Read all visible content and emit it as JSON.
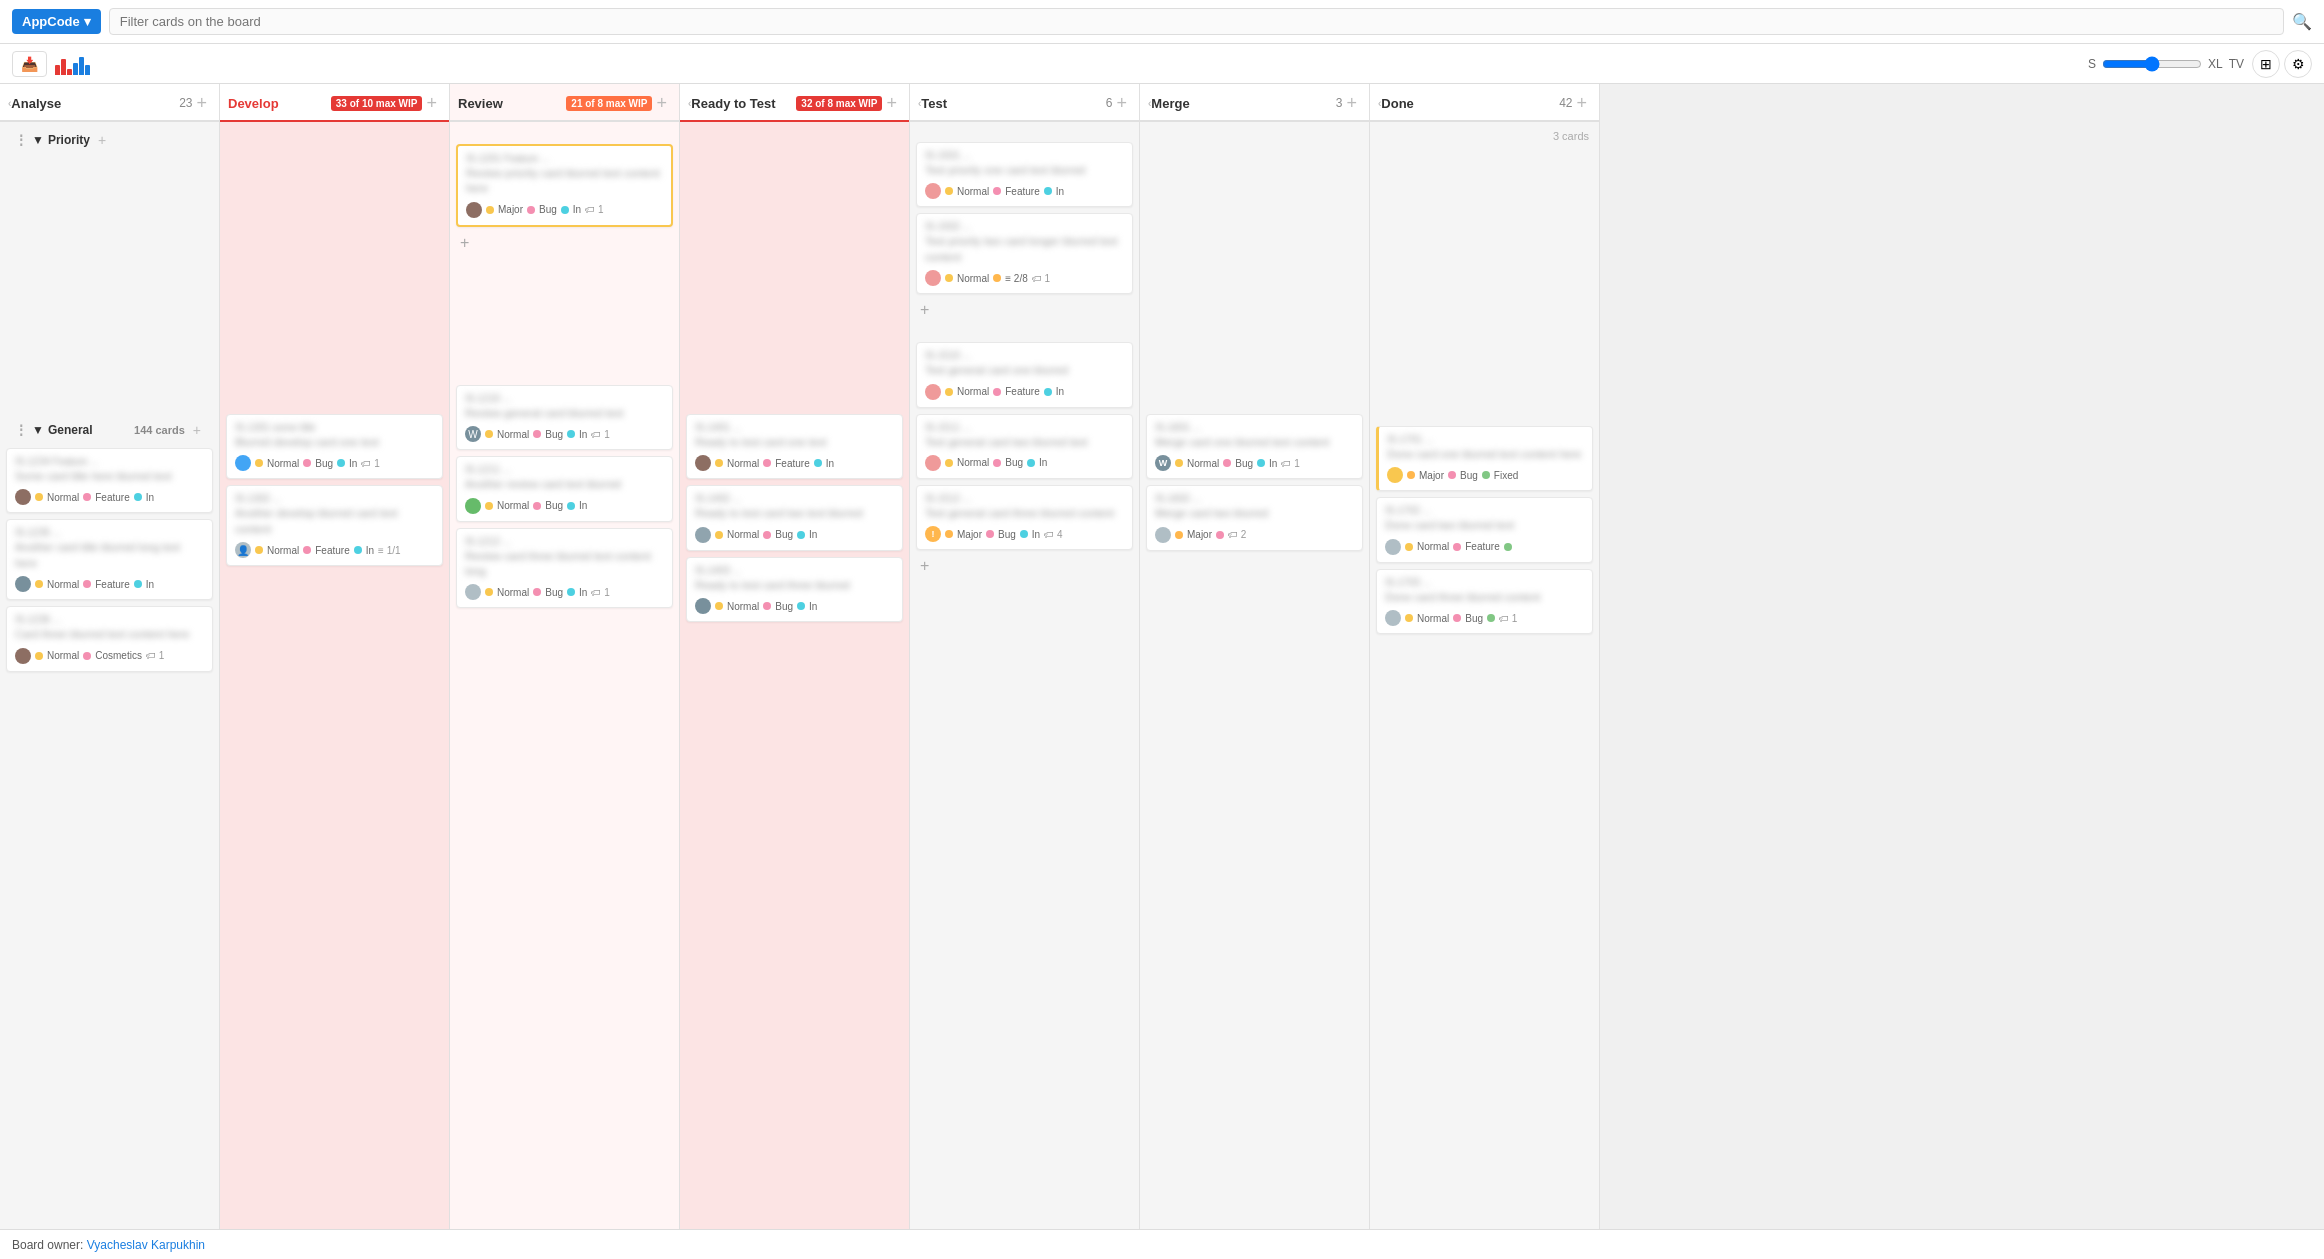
{
  "app": {
    "name": "AppCode",
    "search_placeholder": "Filter cards on the board"
  },
  "toolbar": {
    "size_label_s": "S",
    "size_label_xl": "XL",
    "size_label_tv": "TV"
  },
  "columns": [
    {
      "id": "analyse",
      "title": "Analyse",
      "count": 23,
      "wip": null,
      "collapsed": false
    },
    {
      "id": "develop",
      "title": "Develop",
      "count": null,
      "wip": "33 of 10 max WIP",
      "wip_exceeded": true,
      "collapsed": false
    },
    {
      "id": "review",
      "title": "Review",
      "count": null,
      "wip": "21 of 8 max WIP",
      "wip_exceeded": false,
      "collapsed": false
    },
    {
      "id": "ready_to_test",
      "title": "Ready to Test",
      "count": null,
      "wip": "32 of 8 max WIP",
      "wip_exceeded": true,
      "collapsed": false
    },
    {
      "id": "test",
      "title": "Test",
      "count": 6,
      "wip": null,
      "collapsed": false
    },
    {
      "id": "merge",
      "title": "Merge",
      "count": 3,
      "wip": null,
      "collapsed": false
    },
    {
      "id": "done",
      "title": "Done",
      "count": 42,
      "wip": null,
      "collapsed": false
    }
  ],
  "swimlanes": [
    {
      "id": "priority",
      "title": "Priority",
      "cards_count": ""
    },
    {
      "id": "general",
      "title": "General",
      "cards_count": "144 cards"
    }
  ],
  "footer": {
    "board_owner_label": "Board owner:",
    "board_owner_name": "Vyacheslav Karpukhin"
  }
}
